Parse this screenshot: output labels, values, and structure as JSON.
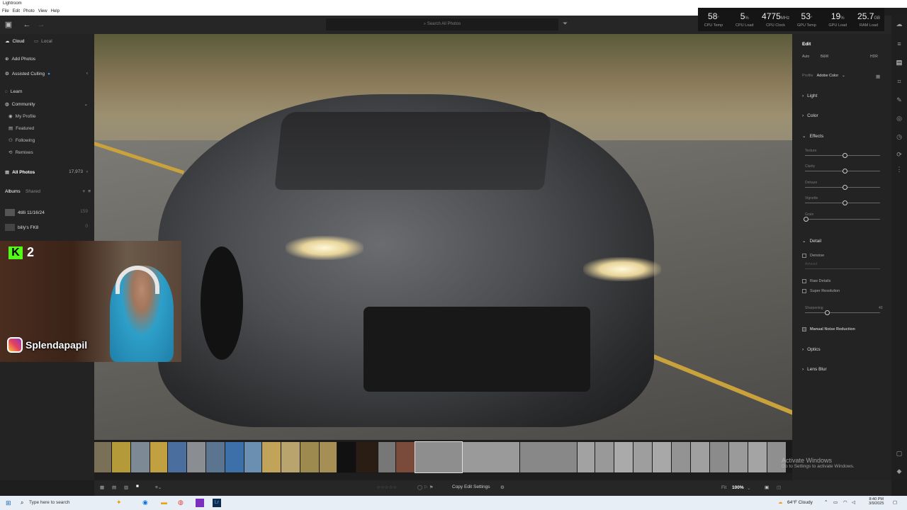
{
  "window": {
    "title": "Lightroom"
  },
  "menu": [
    "File",
    "Edit",
    "Photo",
    "View",
    "Help"
  ],
  "search": {
    "placeholder": "Search All Photos"
  },
  "stats": [
    {
      "value": "58",
      "unit": "°",
      "label": "CPU Temp"
    },
    {
      "value": "5",
      "unit": "%",
      "label": "CPU Load"
    },
    {
      "value": "4775",
      "unit": "MHz",
      "label": "CPU Clock"
    },
    {
      "value": "53",
      "unit": "°",
      "label": "GPU Temp"
    },
    {
      "value": "19",
      "unit": "%",
      "label": "GPU Load"
    },
    {
      "value": "25.7",
      "unit": "GB",
      "label": "RAM Load"
    }
  ],
  "left": {
    "tab_cloud": "Cloud",
    "tab_local": "Local",
    "add_photos": "Add Photos",
    "assisted_culling": "Assisted Culling",
    "learn": "Learn",
    "community": "Community",
    "community_items": [
      "My Profile",
      "Featured",
      "Following",
      "Remixes"
    ],
    "all_photos": "All Photos",
    "all_photos_count": "17,973",
    "albums_tab": "Albums",
    "shared_tab": "Shared",
    "albums": [
      {
        "name": "4tilli 11/16/24",
        "count": "159"
      },
      {
        "name": "billy's FK8",
        "count": "0"
      }
    ]
  },
  "overlay": {
    "kick_count": "2",
    "instagram": "Splendapapil"
  },
  "edit": {
    "title": "Edit",
    "auto": "Auto",
    "bw": "B&W",
    "hdr": "HDR",
    "profile_label": "Profile",
    "profile_value": "Adobe Color",
    "sections": {
      "light": "Light",
      "color": "Color",
      "effects": "Effects",
      "detail": "Detail",
      "optics": "Optics",
      "lens_blur": "Lens Blur"
    },
    "effects_sliders": [
      {
        "label": "Texture",
        "value": "0",
        "pos": 0.5
      },
      {
        "label": "Clarity",
        "value": "0",
        "pos": 0.5
      },
      {
        "label": "Dehaze",
        "value": "0",
        "pos": 0.5
      },
      {
        "label": "Vignette",
        "value": "0",
        "pos": 0.5
      },
      {
        "label": "Grain",
        "value": "0",
        "pos": 0.0
      }
    ],
    "denoise": "Denoise",
    "amount": "Amount",
    "raw_details": "Raw Details",
    "super_resolution": "Super Resolution",
    "sharpening_label": "Sharpening",
    "sharpening_value": "40",
    "sharpening_pos": 0.28,
    "manual_noise": "Manual Noise Reduction"
  },
  "bottom": {
    "copy_edit": "Copy Edit Settings",
    "fit": "Fit",
    "zoom": "100%"
  },
  "activate": {
    "title": "Activate Windows",
    "sub": "Go to Settings to activate Windows."
  },
  "taskbar": {
    "search": "Type here to search",
    "weather": "64°F Cloudy",
    "time": "8:40 PM",
    "date": "3/9/2025"
  },
  "colors": {
    "accent": "#3d8ee6",
    "panel": "#232323",
    "kick": "#53fc18"
  }
}
